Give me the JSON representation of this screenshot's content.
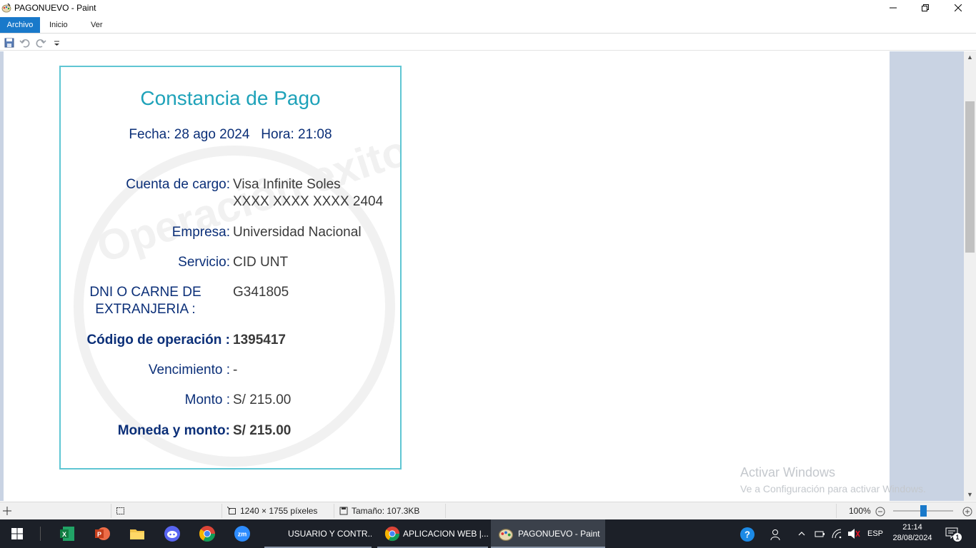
{
  "window": {
    "title": "PAGONUEVO - Paint",
    "minimize_label": "—",
    "maximize_label": "❐",
    "close_label": "✕"
  },
  "ribbon": {
    "tabs": [
      {
        "label": "Archivo"
      },
      {
        "label": "Inicio"
      },
      {
        "label": "Ver"
      }
    ],
    "help_label": "?"
  },
  "receipt": {
    "title": "Constancia de Pago",
    "datetime": "Fecha: 28 ago 2024   Hora: 21:08",
    "watermark": "Operación exitosa",
    "rows": [
      {
        "label": "Cuenta de cargo:",
        "value_line1": "Visa Infinite Soles",
        "value_line2": "XXXX XXXX XXXX 2404"
      },
      {
        "label": "Empresa:",
        "value": "Universidad Nacional"
      },
      {
        "label": "Servicio:",
        "value": "CID UNT"
      },
      {
        "label_line1": "DNI O CARNE DE",
        "label_line2": "EXTRANJERIA :",
        "value": "G341805"
      },
      {
        "label": "Código de operación :",
        "value": "1395417"
      },
      {
        "label": "Vencimiento :",
        "value": "-"
      },
      {
        "label": "Monto :",
        "value": "S/ 215.00"
      },
      {
        "label": "Moneda y monto:",
        "value": "S/ 215.00"
      }
    ]
  },
  "watermark_windows": {
    "line1": "Activar Windows",
    "line2": "Ve a Configuración para activar Windows."
  },
  "statusbar": {
    "dimensions": "1240 × 1755 píxeles",
    "size": "Tamaño: 107.3KB",
    "zoom": "100%",
    "zoom_fraction": 0.5
  },
  "taskbar": {
    "windows": [
      {
        "label": "USUARIO Y CONTR..."
      },
      {
        "label": "APLICACION WEB |..."
      },
      {
        "label": "PAGONUEVO - Paint"
      }
    ],
    "language": "ESP",
    "time": "21:14",
    "date": "28/08/2024",
    "notification_count": "1"
  },
  "colors": {
    "accent": "#1979ca",
    "receipt_border": "#5fc6d3",
    "receipt_title": "#1ea2b9",
    "receipt_label": "#0b2f78",
    "canvas_bg": "#c9d3e3",
    "taskbar": "#1c2028"
  }
}
